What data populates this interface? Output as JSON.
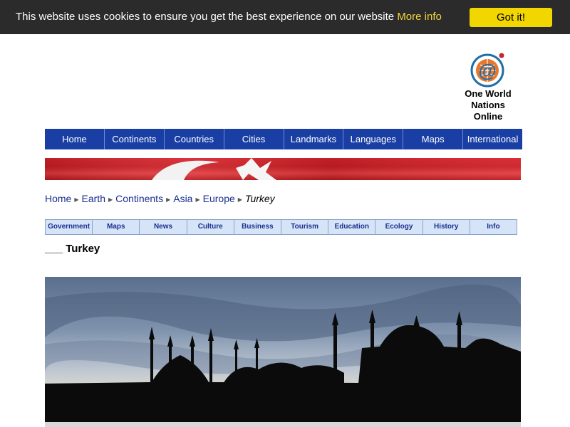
{
  "cookie": {
    "message": "This website uses cookies to ensure you get the best experience on our website",
    "more_info": "More info",
    "button": "Got it!"
  },
  "logo": {
    "line1": "One World",
    "line2": "Nations Online"
  },
  "main_nav": [
    "Home",
    "Continents",
    "Countries",
    "Cities",
    "Landmarks",
    "Languages",
    "Maps",
    "International"
  ],
  "breadcrumb": {
    "items": [
      "Home",
      "Earth",
      "Continents",
      "Asia",
      "Europe"
    ],
    "current": "Turkey"
  },
  "topic_tabs": [
    "Government",
    "Maps",
    "News",
    "Culture",
    "Business",
    "Tourism",
    "Education",
    "Ecology",
    "History",
    "Info"
  ],
  "page_title": "___ Turkey",
  "colors": {
    "cookie_bg": "#2b2b2b",
    "cookie_button": "#f1d600",
    "nav_bg": "#1a3fa4",
    "tab_bg": "#d6e4f7",
    "flag_red": "#d8222a"
  }
}
